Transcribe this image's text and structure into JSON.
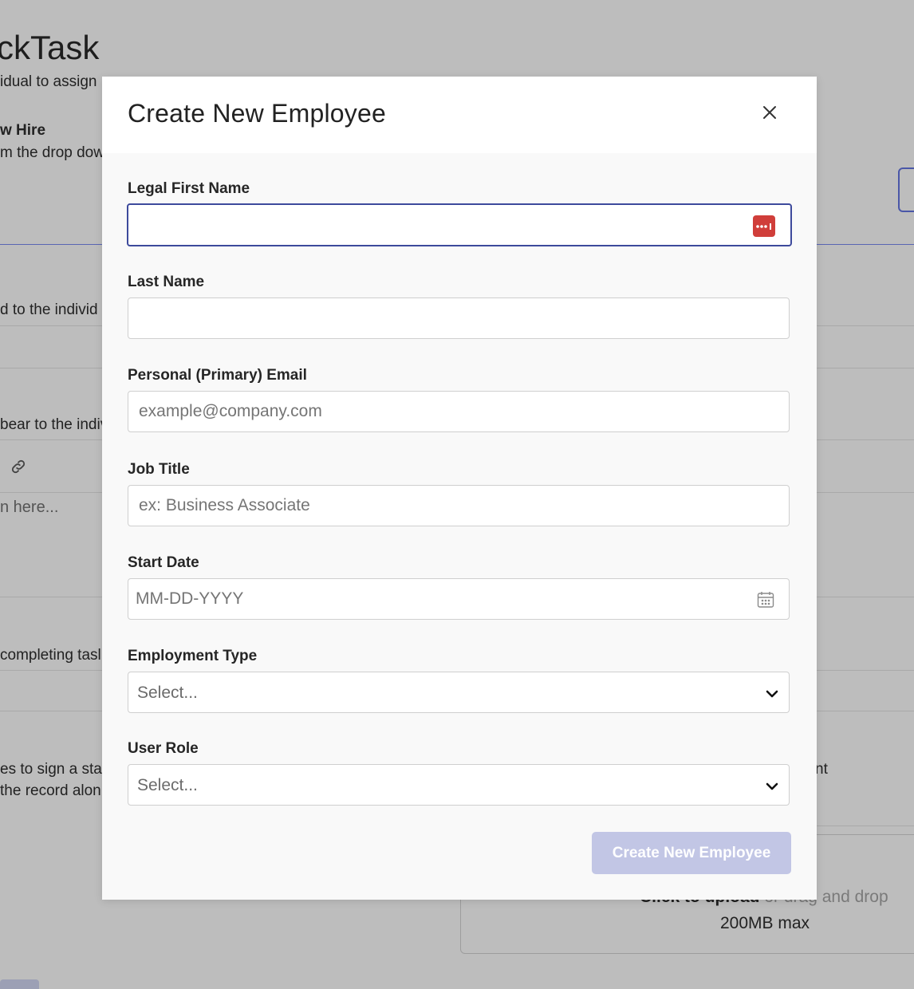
{
  "background": {
    "app_title": "ckTask",
    "subtitle": "idual to assign",
    "new_hire_heading": "w Hire",
    "new_hire_hint": "m the drop dow",
    "row1_text": "d to the individ",
    "row2_text": "bear to the indiv",
    "editor_placeholder": "n here...",
    "row3_text": "completing tasl",
    "row4_line1": "es to sign a stat",
    "row4_line2": " the record alon",
    "right_fragment": "nt",
    "upload_click": "Click to upload",
    "upload_or": " or drag and drop",
    "upload_limit": "200MB max",
    "link_icon": "link-icon"
  },
  "modal": {
    "title": "Create New Employee",
    "close_icon": "close-icon",
    "fields": {
      "first_name": {
        "label": "Legal First Name",
        "value": "",
        "placeholder": "",
        "icon": "password-manager-icon"
      },
      "last_name": {
        "label": "Last Name",
        "value": "",
        "placeholder": ""
      },
      "email": {
        "label": "Personal (Primary) Email",
        "value": "",
        "placeholder": "example@company.com"
      },
      "job_title": {
        "label": "Job Title",
        "value": "",
        "placeholder": "ex: Business Associate"
      },
      "start_date": {
        "label": "Start Date",
        "value": "",
        "placeholder": "MM-DD-YYYY",
        "icon": "calendar-icon"
      },
      "employment_type": {
        "label": "Employment Type",
        "selected": "Select...",
        "icon": "chevron-down-icon"
      },
      "user_role": {
        "label": "User Role",
        "selected": "Select...",
        "icon": "chevron-down-icon"
      }
    },
    "submit_label": "Create New Employee"
  },
  "colors": {
    "overlay": "#bdbdbd",
    "focus_border": "#3d4a9c",
    "submit_disabled": "#c2c6e5",
    "password_icon": "#d03e3a"
  }
}
